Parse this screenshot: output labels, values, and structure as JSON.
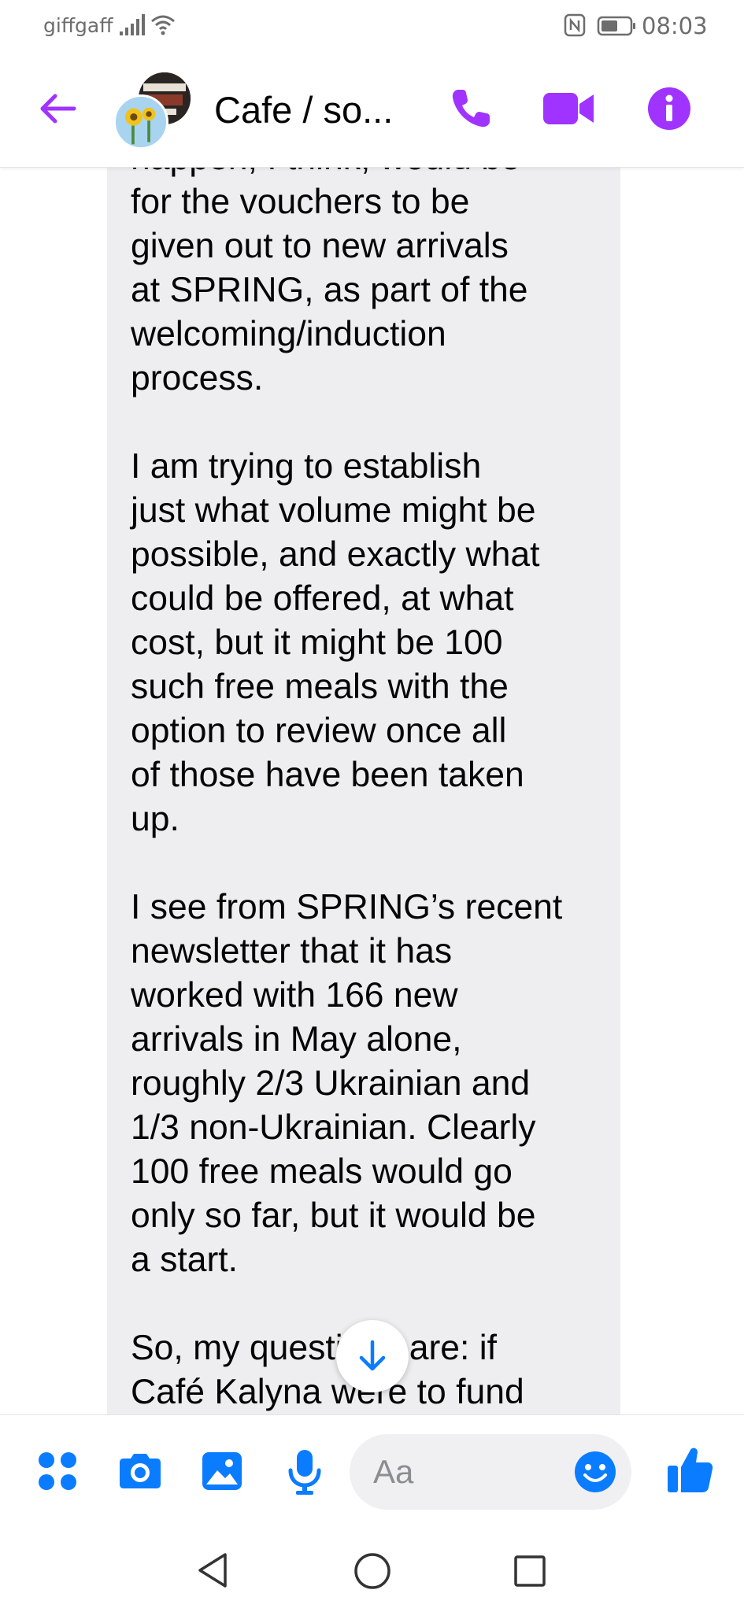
{
  "status_bar": {
    "carrier": "giffgaff",
    "time": "08:03"
  },
  "header": {
    "title": "Cafe / so...",
    "icons": [
      "back-arrow-icon",
      "phone-icon",
      "video-camera-icon",
      "info-icon"
    ],
    "accent_color": "#a033ff"
  },
  "message": {
    "paragraphs": [
      [
        "happen, I think, would be",
        "for the vouchers to be",
        "given out to new arrivals",
        "at SPRING, as part of the",
        "welcoming/induction",
        "process."
      ],
      [
        "I am trying to establish",
        "just what volume might be",
        "possible, and exactly what",
        "could be offered, at what",
        "cost, but it might be 100",
        "such free meals with the",
        "option to review once all",
        "of those have been taken",
        "up."
      ],
      [
        "I see from SPRING’s recent",
        "newsletter that it has",
        "worked with 166 new",
        "arrivals in May alone,",
        "roughly 2/3 Ukrainian and",
        "1/3 non-Ukrainian. Clearly",
        "100 free meals would go",
        "only so far, but it would be",
        "a start."
      ],
      [
        "So, my questions are: if",
        "Café Kalyna were to fund"
      ]
    ],
    "bubble_color": "#eeeef0"
  },
  "composer": {
    "placeholder": "Aa",
    "icon_color": "#0a7cff",
    "icons": [
      "apps-grid-icon",
      "camera-icon",
      "gallery-icon",
      "microphone-icon",
      "emoji-icon",
      "thumbs-up-icon"
    ]
  },
  "navbar": {
    "icons": [
      "nav-back-icon",
      "nav-home-icon",
      "nav-recent-icon"
    ]
  }
}
